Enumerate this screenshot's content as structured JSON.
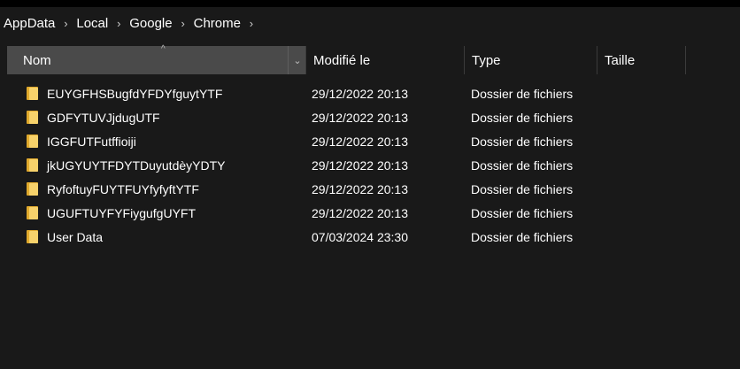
{
  "breadcrumb": {
    "items": [
      "AppData",
      "Local",
      "Google",
      "Chrome"
    ],
    "separator": "›"
  },
  "header": {
    "name": "Nom",
    "date": "Modifié le",
    "type": "Type",
    "size": "Taille",
    "sort_glyph": "^",
    "dropdown_glyph": "⌄"
  },
  "files": [
    {
      "name": "EUYGFHSBugfdYFDYfguytYTF",
      "date": "29/12/2022 20:13",
      "type": "Dossier de fichiers",
      "size": ""
    },
    {
      "name": "GDFYTUVJjdugUTF",
      "date": "29/12/2022 20:13",
      "type": "Dossier de fichiers",
      "size": ""
    },
    {
      "name": "IGGFUTFutffioiji",
      "date": "29/12/2022 20:13",
      "type": "Dossier de fichiers",
      "size": ""
    },
    {
      "name": "jkUGYUYTFDYTDuyutdèyYDTY",
      "date": "29/12/2022 20:13",
      "type": "Dossier de fichiers",
      "size": ""
    },
    {
      "name": "RyfoftuyFUYTFUYfyfyftYTF",
      "date": "29/12/2022 20:13",
      "type": "Dossier de fichiers",
      "size": ""
    },
    {
      "name": "UGUFTUYFYFiygufgUYFT",
      "date": "29/12/2022 20:13",
      "type": "Dossier de fichiers",
      "size": ""
    },
    {
      "name": "User Data",
      "date": "07/03/2024 23:30",
      "type": "Dossier de fichiers",
      "size": ""
    }
  ],
  "icons": {
    "folder": "folder-icon",
    "separator": "chevron-right-icon",
    "sort": "sort-ascending-icon",
    "dropdown": "chevron-down-icon"
  },
  "colors": {
    "background": "#191919",
    "header_active": "#4a4a4a",
    "folder_back": "#e0a92c",
    "folder_front": "#f7d26b"
  }
}
